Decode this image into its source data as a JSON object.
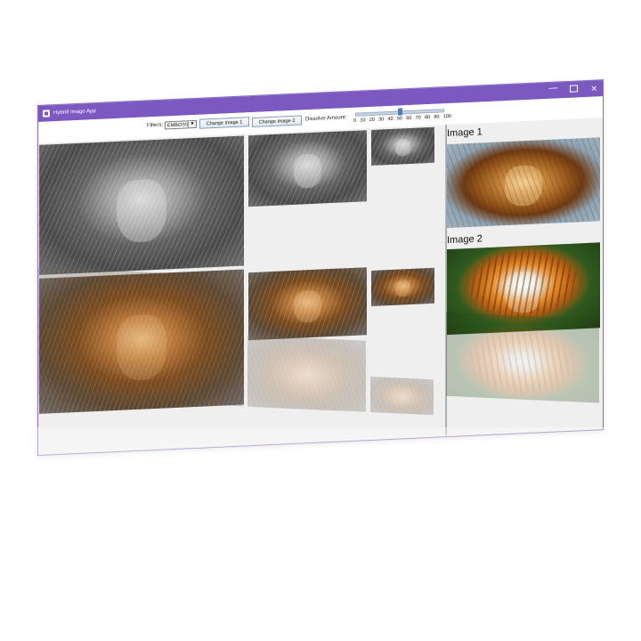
{
  "window": {
    "title": "Hybrid Image App",
    "minimize_glyph": "—",
    "maximize_glyph": "",
    "close_glyph": "✕",
    "accent_color": "#7b59c0"
  },
  "toolbar": {
    "filters_label": "Filters:",
    "filter_selected": "EMBOSS",
    "change_image_1": "Change Image 1",
    "change_image_2": "Change Image 2",
    "dissolve_label": "Dissolve Amount:",
    "slider_value": 50,
    "slider_ticks": [
      "0",
      "10",
      "20",
      "30",
      "40",
      "50",
      "60",
      "70",
      "80",
      "90",
      "100"
    ]
  },
  "right_panel": {
    "image1_label": "Image 1",
    "image2_label": "Image 2"
  },
  "icons": {
    "app": "app-icon",
    "dropdown": "chevron-down-icon"
  }
}
